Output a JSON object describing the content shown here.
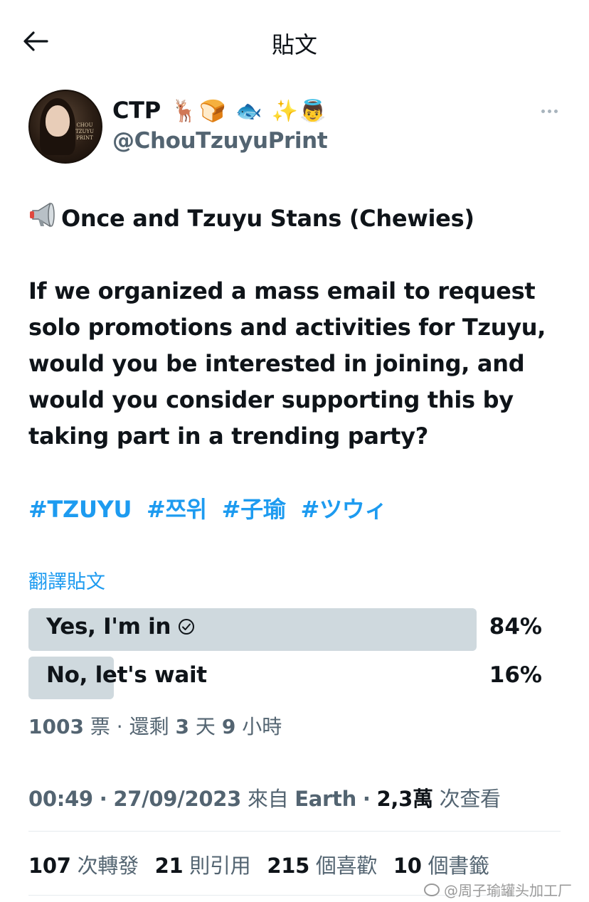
{
  "header": {
    "title": "貼文",
    "back_icon": "arrow-left-icon"
  },
  "author": {
    "display_name": "CTP",
    "emojis": "🦌🍞 🐟 ✨👼",
    "handle": "@ChouTzuyuPrint",
    "avatar_logo_text": "CHOU TZUYU PRINT",
    "more_icon": "more-horizontal-icon"
  },
  "tweet": {
    "megaphone_icon": "megaphone-icon",
    "heading": "Once and Tzuyu Stans (Chewies)",
    "body": "If we organized a mass email to request solo promotions and activities for Tzuyu, would you be interested in joining, and would you consider supporting this by taking part in a trending party?",
    "hashtags": [
      "#TZUYU",
      "#쯔위",
      "#子瑜",
      "#ツウィ"
    ]
  },
  "translate_label": "翻譯貼文",
  "poll": {
    "options": [
      {
        "label": "Yes, I'm in",
        "percent_text": "84%",
        "percent": 84,
        "selected": true
      },
      {
        "label": "No, let's wait",
        "percent_text": "16%",
        "percent": 16,
        "selected": false
      }
    ],
    "votes": "1003",
    "votes_label": "票",
    "sep": "·",
    "remaining_prefix": "還剩",
    "days": "3",
    "days_label": "天",
    "hours": "9",
    "hours_label": "小時",
    "check_icon": "check-circle-icon"
  },
  "meta": {
    "time": "00:49",
    "date": "27/09/2023",
    "source_prefix": "來自",
    "source": "Earth",
    "views": "2,3萬",
    "views_label": "次查看",
    "sep": "·"
  },
  "stats": {
    "retweets": "107",
    "retweets_label": "次轉發",
    "quotes": "21",
    "quotes_label": "則引用",
    "likes": "215",
    "likes_label": "個喜歡",
    "bookmarks": "10",
    "bookmarks_label": "個書籤"
  },
  "watermark": {
    "text": "@周子瑜罐头加工厂",
    "icon": "weibo-icon"
  },
  "colors": {
    "accent": "#1d9bf0",
    "text": "#0f1419",
    "muted": "#536471",
    "poll_bar": "#cfd9de",
    "divider": "#e6ebee"
  }
}
